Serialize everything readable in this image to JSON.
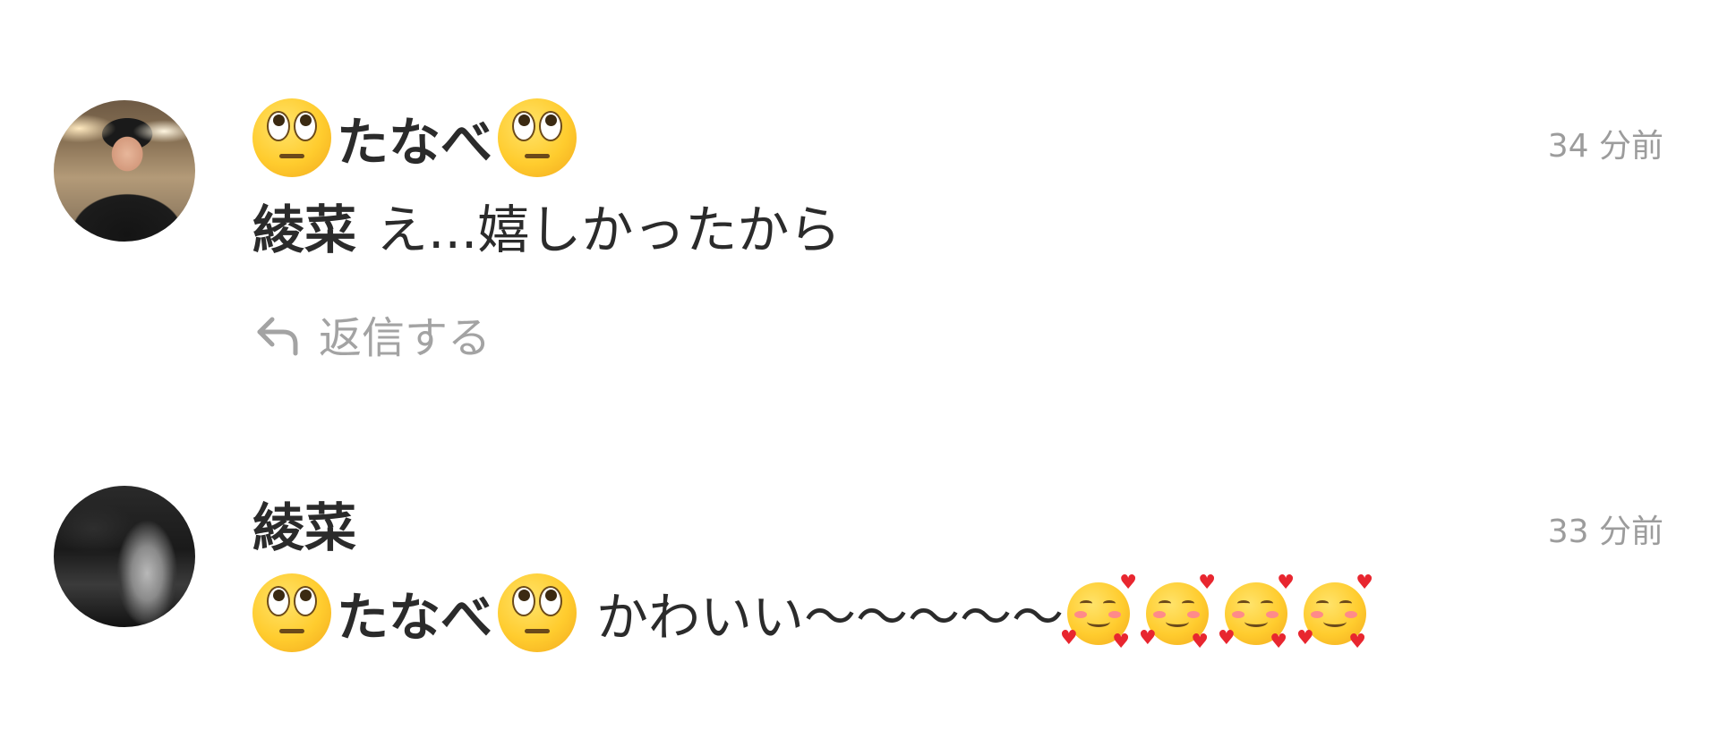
{
  "comments": [
    {
      "author": "たなべ",
      "author_emoji": "face-with-rolling-eyes",
      "timestamp": "34 分前",
      "mention": "綾菜",
      "text": "え...嬉しかったから",
      "reply_label": "返信する"
    },
    {
      "author": "綾菜",
      "timestamp": "33 分前",
      "mention": "たなべ",
      "mention_emoji": "face-with-rolling-eyes",
      "text": "かわいい〜〜〜〜〜",
      "trailing_emoji": [
        "smiling-face-with-hearts",
        "smiling-face-with-hearts",
        "smiling-face-with-hearts",
        "smiling-face-with-hearts"
      ]
    }
  ],
  "colors": {
    "text": "#2b2b2b",
    "muted": "#9c9c9c",
    "background": "#ffffff"
  }
}
